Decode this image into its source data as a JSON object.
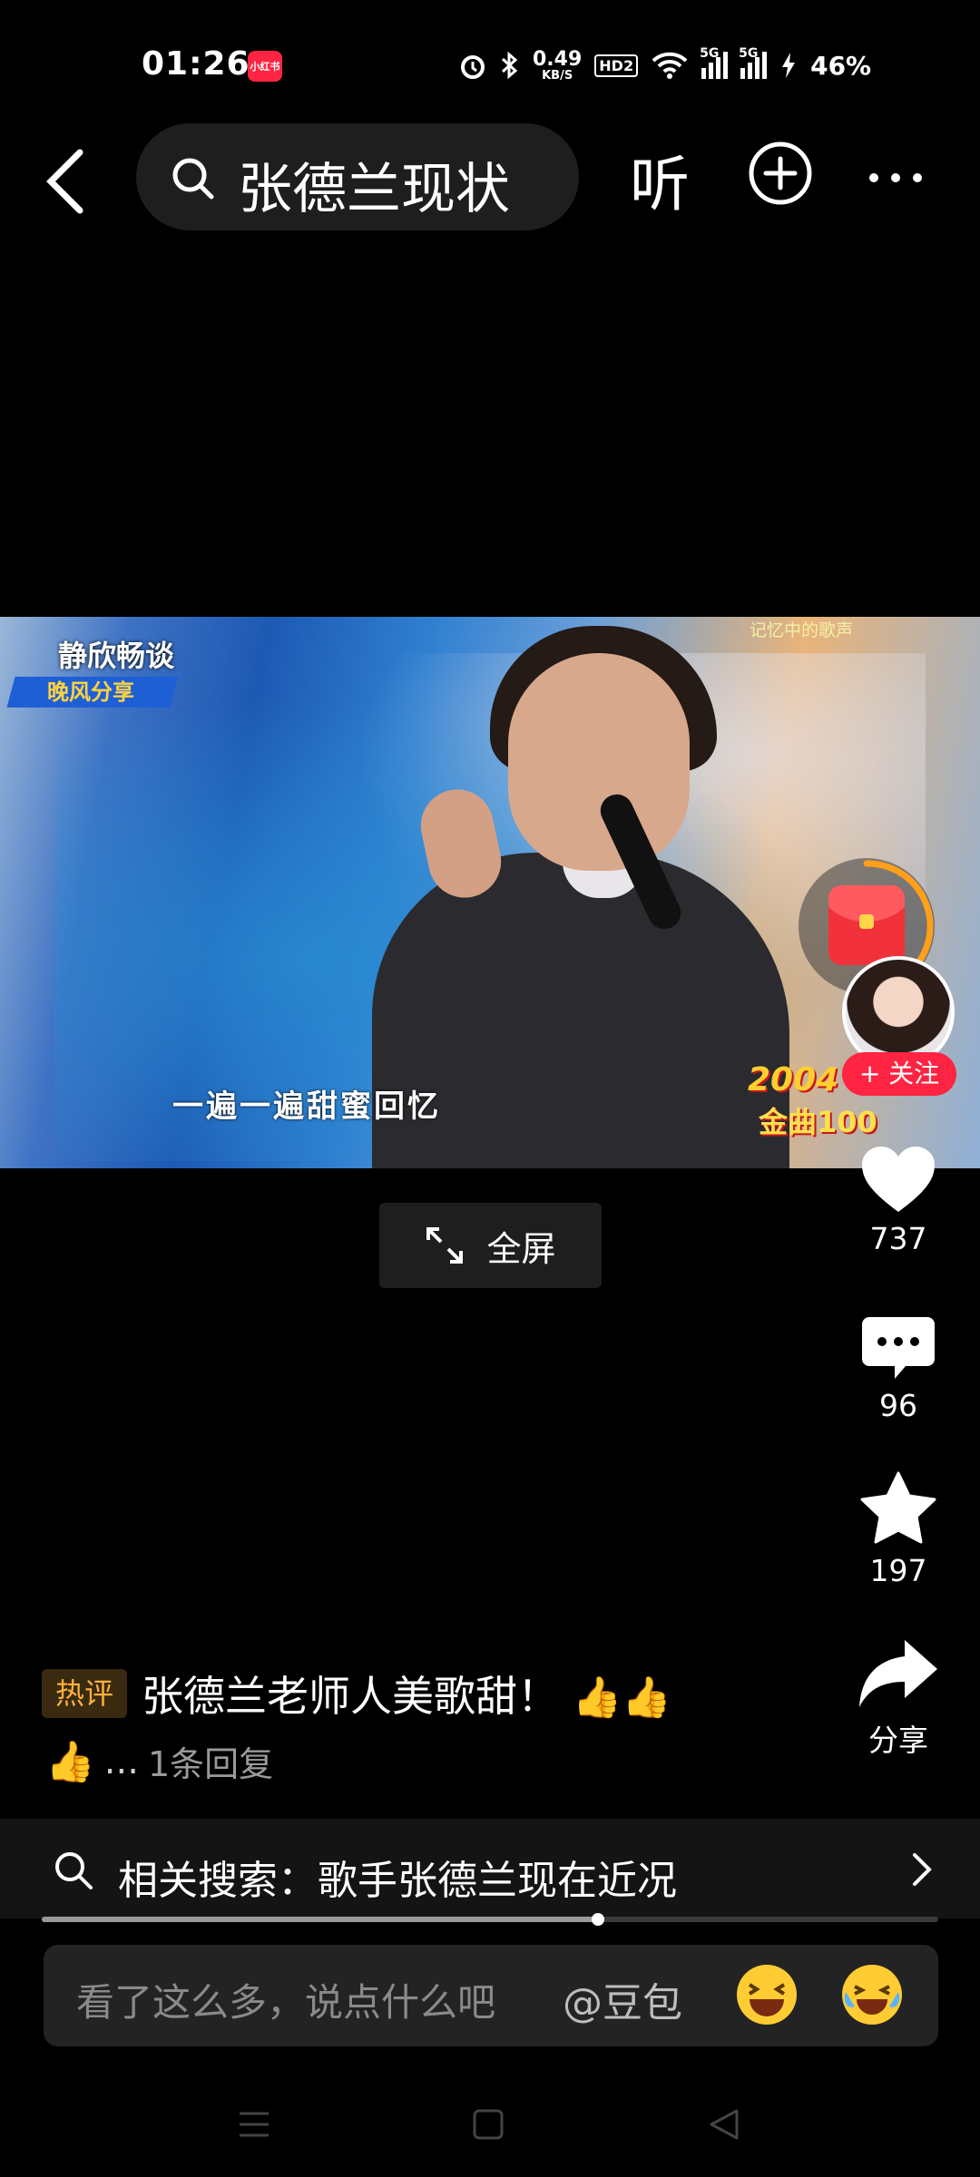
{
  "status_bar": {
    "time": "01:26",
    "app_badge": "小红书",
    "net_speed_value": "0.49",
    "net_speed_unit": "KB/S",
    "hd_label": "HD2",
    "signal_1_label": "5G",
    "signal_2_label": "5G",
    "battery": "46%"
  },
  "top_bar": {
    "search_query": "张德兰现状",
    "listen_label": "听"
  },
  "video": {
    "watermark_channel": "静欣畅谈",
    "watermark_tag": "晚风分享",
    "watermark_top": "记忆中的歌声",
    "subtitle": "一遍一遍甜蜜回忆",
    "logo_year": "2004",
    "logo_title": "金曲100"
  },
  "fullscreen_label": "全屏",
  "actions": {
    "follow_label": "+ 关注",
    "likes": "737",
    "comments": "96",
    "favorites": "197",
    "share_label": "分享"
  },
  "hot_comment": {
    "tag": "热评",
    "text": "张德兰老师人美歌甜！",
    "ellipsis": "...",
    "reply_count": "1条回复"
  },
  "related_search": {
    "text": "相关搜索：歌手张德兰现在近况"
  },
  "playback": {
    "progress": 0.62
  },
  "comment_bar": {
    "placeholder": "看了这么多，说点什么吧",
    "mention": "@豆包"
  }
}
